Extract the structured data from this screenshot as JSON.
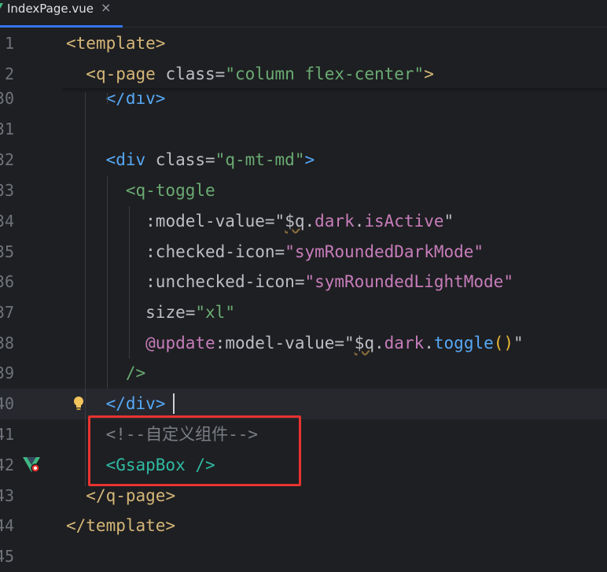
{
  "tab": {
    "filename": "IndexPage.vue",
    "close_glyph": "×"
  },
  "lines": [
    {
      "num": "1",
      "tokens": [
        {
          "t": "<template>",
          "c": "t-tag"
        }
      ]
    },
    {
      "num": "2",
      "tokens": [
        {
          "t": "  "
        },
        {
          "t": "<q-page",
          "c": "t-tag"
        },
        {
          "t": " class",
          "c": "t-attr"
        },
        {
          "t": "=",
          "c": "t-plain"
        },
        {
          "t": "\"column flex-center\"",
          "c": "t-str"
        },
        {
          "t": ">",
          "c": "t-tag"
        }
      ]
    },
    {
      "num": "30",
      "tokens": [
        {
          "t": "    "
        },
        {
          "t": "</div>",
          "c": "t-tagv"
        }
      ]
    },
    {
      "num": "31",
      "tokens": []
    },
    {
      "num": "32",
      "tokens": [
        {
          "t": "    "
        },
        {
          "t": "<div",
          "c": "t-tagv"
        },
        {
          "t": " class",
          "c": "t-attr"
        },
        {
          "t": "=",
          "c": "t-plain"
        },
        {
          "t": "\"q-mt-md\"",
          "c": "t-str"
        },
        {
          "t": ">",
          "c": "t-tagv"
        }
      ]
    },
    {
      "num": "33",
      "tokens": [
        {
          "t": "      "
        },
        {
          "t": "<q-toggle",
          "c": "t-str"
        }
      ]
    },
    {
      "num": "34",
      "tokens": [
        {
          "t": "        "
        },
        {
          "t": ":model-value",
          "c": "t-attr"
        },
        {
          "t": "=",
          "c": "t-plain"
        },
        {
          "t": "\"",
          "c": "t-plain"
        },
        {
          "t": "$q",
          "c": "t-plain squig"
        },
        {
          "t": ".",
          "c": "t-plain"
        },
        {
          "t": "dark",
          "c": "t-purple"
        },
        {
          "t": ".",
          "c": "t-plain"
        },
        {
          "t": "isActive",
          "c": "t-purple"
        },
        {
          "t": "\"",
          "c": "t-plain"
        }
      ]
    },
    {
      "num": "35",
      "tokens": [
        {
          "t": "        "
        },
        {
          "t": ":checked-icon",
          "c": "t-attr"
        },
        {
          "t": "=",
          "c": "t-plain"
        },
        {
          "t": "\"symRoundedDarkMode\"",
          "c": "t-purple"
        }
      ]
    },
    {
      "num": "36",
      "tokens": [
        {
          "t": "        "
        },
        {
          "t": ":unchecked-icon",
          "c": "t-attr"
        },
        {
          "t": "=",
          "c": "t-plain"
        },
        {
          "t": "\"symRoundedLightMode\"",
          "c": "t-purple"
        }
      ]
    },
    {
      "num": "37",
      "tokens": [
        {
          "t": "        "
        },
        {
          "t": "size",
          "c": "t-attr"
        },
        {
          "t": "=",
          "c": "t-plain"
        },
        {
          "t": "\"xl\"",
          "c": "t-str"
        }
      ]
    },
    {
      "num": "38",
      "tokens": [
        {
          "t": "        "
        },
        {
          "t": "@update",
          "c": "t-purple"
        },
        {
          "t": ":model-value",
          "c": "t-attr"
        },
        {
          "t": "=",
          "c": "t-plain"
        },
        {
          "t": "\"",
          "c": "t-plain"
        },
        {
          "t": "$q",
          "c": "t-plain squig"
        },
        {
          "t": ".",
          "c": "t-plain"
        },
        {
          "t": "dark",
          "c": "t-purple"
        },
        {
          "t": ".",
          "c": "t-plain"
        },
        {
          "t": "toggle",
          "c": "t-blue"
        },
        {
          "t": "()",
          "c": "t-paren"
        },
        {
          "t": "\"",
          "c": "t-plain"
        }
      ]
    },
    {
      "num": "39",
      "tokens": [
        {
          "t": "      "
        },
        {
          "t": "/>",
          "c": "t-str"
        }
      ]
    },
    {
      "num": "40",
      "tokens": [
        {
          "t": "    "
        },
        {
          "t": "</div>",
          "c": "t-tagv"
        }
      ],
      "current": true
    },
    {
      "num": "41",
      "tokens": [
        {
          "t": "    "
        },
        {
          "t": "<!--自定义组件-->",
          "c": "t-comment"
        }
      ]
    },
    {
      "num": "42",
      "tokens": [
        {
          "t": "    "
        },
        {
          "t": "<GsapBox",
          "c": "t-teal"
        },
        {
          "t": " />",
          "c": "t-teal"
        }
      ]
    },
    {
      "num": "43",
      "tokens": [
        {
          "t": "  "
        },
        {
          "t": "</q-page>",
          "c": "t-tag"
        }
      ]
    },
    {
      "num": "44",
      "tokens": [
        {
          "t": "</template>",
          "c": "t-tag"
        }
      ]
    },
    {
      "num": "45",
      "tokens": []
    }
  ],
  "colors": {
    "highlight_box": "#e8332f",
    "accent": "#3574f0",
    "background": "#1e1f22"
  },
  "icons": {
    "bulb": "lightbulb-icon",
    "vue": "vue-component-icon"
  }
}
